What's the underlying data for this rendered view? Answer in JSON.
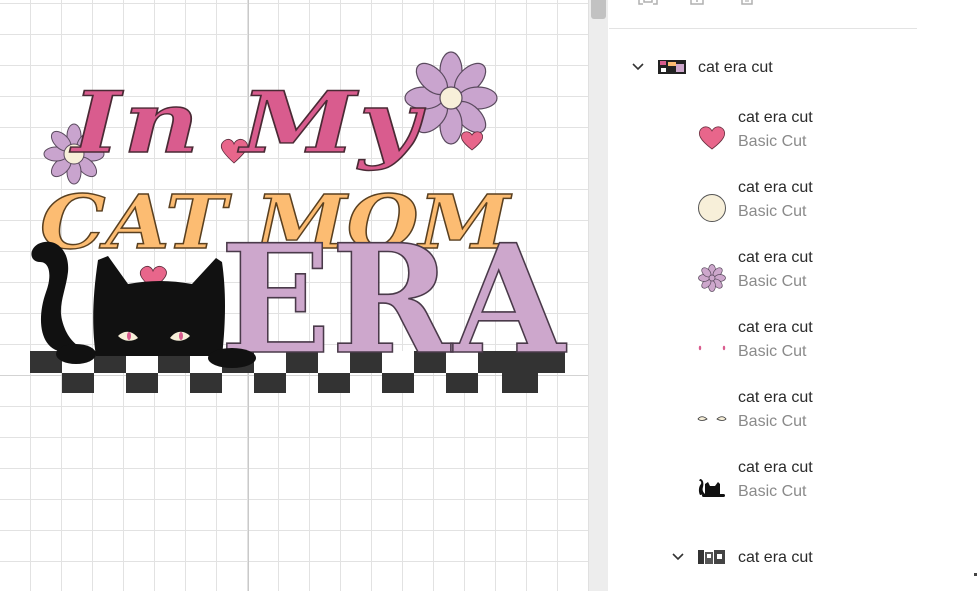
{
  "canvas": {
    "design": {
      "line1": "In My",
      "line2": "CAT MOM",
      "line3": "ERA",
      "colors": {
        "pink": "#d95c8e",
        "orange": "#fcbc72",
        "lavender": "#cda7cc",
        "flower": "#c9a4ce",
        "cream": "#f7efd9",
        "black": "#111111",
        "checker": "#333333",
        "heart": "#e8668b"
      }
    }
  },
  "toolbar": {
    "icons": [
      "group-icon",
      "duplicate-icon",
      "delete-icon"
    ]
  },
  "layers": {
    "group": {
      "name": "cat era cut",
      "expanded": true,
      "icon": "chevron-down-icon"
    },
    "items": [
      {
        "name": "cat era cut",
        "operation": "Basic Cut",
        "thumb": "heart",
        "color": "#e8668b"
      },
      {
        "name": "cat era cut",
        "operation": "Basic Cut",
        "thumb": "circle",
        "color": "#f7efd9"
      },
      {
        "name": "cat era cut",
        "operation": "Basic Cut",
        "thumb": "flower",
        "color": "#cda7cc"
      },
      {
        "name": "cat era cut",
        "operation": "Basic Cut",
        "thumb": "pupils",
        "color": "#d95c8e"
      },
      {
        "name": "cat era cut",
        "operation": "Basic Cut",
        "thumb": "eyes",
        "color": "#f7efd9"
      },
      {
        "name": "cat era cut",
        "operation": "Basic Cut",
        "thumb": "cat",
        "color": "#111111"
      }
    ],
    "subgroup": {
      "name": "cat era cut",
      "expanded": true,
      "icon": "chevron-down-icon"
    }
  }
}
